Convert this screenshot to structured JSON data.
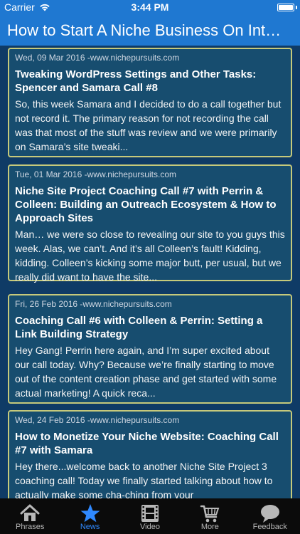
{
  "status": {
    "carrier": "Carrier",
    "time": "3:44 PM"
  },
  "header": {
    "title": "How to Start A Niche Business On Inter..."
  },
  "articles": [
    {
      "meta": "Wed, 09 Mar 2016 -www.nichepursuits.com",
      "title": "Tweaking WordPress Settings and Other Tasks: Spencer and Samara Call #8",
      "excerpt": "So, this week Samara and I decided to do a call together but not record it.  The primary reason for not recording the call was that most of the stuff was review and we were primarily on Samara’s site tweaki..."
    },
    {
      "meta": "Tue, 01 Mar 2016 -www.nichepursuits.com",
      "title": "Niche Site Project Coaching Call #7 with Perrin & Colleen: Building an Outreach Ecosystem & How to Approach Sites",
      "excerpt": "Man… we were so close to revealing our site to you guys this week. Alas, we can’t. And it’s all Colleen’s fault! Kidding, kidding. Colleen’s kicking some major butt, per usual, but we really did want to have the site..."
    },
    {
      "meta": "Fri, 26 Feb 2016 -www.nichepursuits.com",
      "title": "Coaching Call #6 with Colleen & Perrin: Setting a Link Building Strategy",
      "excerpt": "Hey Gang! Perrin here again, and I’m super excited about our call today. Why? Because we’re finally starting to move out of the content creation phase and get started with some actual marketing! A quick reca..."
    },
    {
      "meta": "Wed, 24 Feb 2016 -www.nichepursuits.com",
      "title": "How to Monetize Your Niche Website: Coaching Call #7 with Samara",
      "excerpt": "Hey there...welcome back to another Niche Site Project 3 coaching call!  Today we finally started talking about how to actually make some cha-ching from your"
    }
  ],
  "tabs": [
    {
      "label": "Phrases",
      "icon": "home-icon",
      "active": false
    },
    {
      "label": "News",
      "icon": "star-icon",
      "active": true
    },
    {
      "label": "Video",
      "icon": "film-icon",
      "active": false
    },
    {
      "label": "More",
      "icon": "cart-icon",
      "active": false
    },
    {
      "label": "Feedback",
      "icon": "chat-bubble-icon",
      "active": false
    }
  ],
  "colors": {
    "nav": "#1f78d1",
    "page": "#0f3b66",
    "card": "#174d6f",
    "border": "#c6c97b",
    "tab_active": "#2f89ff"
  }
}
